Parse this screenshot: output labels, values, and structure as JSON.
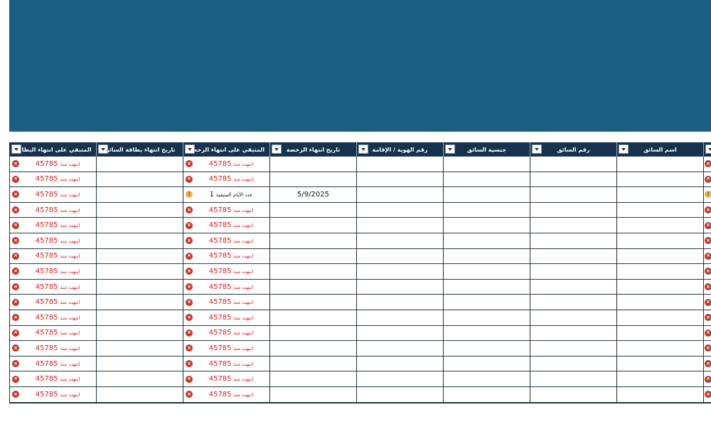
{
  "colors": {
    "banner": "#1b5e84",
    "header_bg": "#16324f",
    "error": "#c0392b",
    "warning": "#e6b54a",
    "error_text": "#e02020"
  },
  "icons": {
    "error": "x-circle-icon",
    "warning": "info-circle-icon",
    "dropdown": "chevron-down-icon"
  },
  "headers": [
    "المتبقي على انتهاء البطاقة",
    "تاريخ انتهاء بطاقة السائق",
    "المتبقي على انتهاء الرخصة",
    "تاريخ انتهاء الرخصة",
    "رقم الهوية / الإقامة",
    "جنسية السائق",
    "رقم السائق",
    "اسم السائق",
    ""
  ],
  "expired_label": "انتهت منذ",
  "expired_value": "45785",
  "remaining_label": "عدد الأيام المتبقية",
  "remaining_value": "1",
  "rows": [
    {
      "card_num": "45785",
      "card_lbl": "انتهت منذ",
      "card_date": "",
      "lic_num": "45785",
      "lic_lbl": "انتهت منذ",
      "lic_date": ""
    },
    {
      "card_num": "45785",
      "card_lbl": "انتهت منذ",
      "card_date": "",
      "lic_num": "45785",
      "lic_lbl": "انتهت منذ",
      "lic_date": ""
    },
    {
      "card_num": "45785",
      "card_lbl": "انتهت منذ",
      "card_date": "",
      "lic_num": "1",
      "lic_lbl": "عدد الأيام المتبقية",
      "lic_date": "5/9/2025"
    },
    {
      "card_num": "45785",
      "card_lbl": "انتهت منذ",
      "card_date": "",
      "lic_num": "45785",
      "lic_lbl": "انتهت منذ",
      "lic_date": ""
    },
    {
      "card_num": "45785",
      "card_lbl": "انتهت منذ",
      "card_date": "",
      "lic_num": "45785",
      "lic_lbl": "انتهت منذ",
      "lic_date": ""
    },
    {
      "card_num": "45785",
      "card_lbl": "انتهت منذ",
      "card_date": "",
      "lic_num": "45785",
      "lic_lbl": "انتهت منذ",
      "lic_date": ""
    },
    {
      "card_num": "45785",
      "card_lbl": "انتهت منذ",
      "card_date": "",
      "lic_num": "45785",
      "lic_lbl": "انتهت منذ",
      "lic_date": ""
    },
    {
      "card_num": "45785",
      "card_lbl": "انتهت منذ",
      "card_date": "",
      "lic_num": "45785",
      "lic_lbl": "انتهت منذ",
      "lic_date": ""
    },
    {
      "card_num": "45785",
      "card_lbl": "انتهت منذ",
      "card_date": "",
      "lic_num": "45785",
      "lic_lbl": "انتهت منذ",
      "lic_date": ""
    },
    {
      "card_num": "45785",
      "card_lbl": "انتهت منذ",
      "card_date": "",
      "lic_num": "45785",
      "lic_lbl": "انتهت منذ",
      "lic_date": ""
    },
    {
      "card_num": "45785",
      "card_lbl": "انتهت منذ",
      "card_date": "",
      "lic_num": "45785",
      "lic_lbl": "انتهت منذ",
      "lic_date": ""
    },
    {
      "card_num": "45785",
      "card_lbl": "انتهت منذ",
      "card_date": "",
      "lic_num": "45785",
      "lic_lbl": "انتهت منذ",
      "lic_date": ""
    },
    {
      "card_num": "45785",
      "card_lbl": "انتهت منذ",
      "card_date": "",
      "lic_num": "45785",
      "lic_lbl": "انتهت منذ",
      "lic_date": ""
    },
    {
      "card_num": "45785",
      "card_lbl": "انتهت منذ",
      "card_date": "",
      "lic_num": "45785",
      "lic_lbl": "انتهت منذ",
      "lic_date": ""
    },
    {
      "card_num": "45785",
      "card_lbl": "انتهت منذ",
      "card_date": "",
      "lic_num": "45785",
      "lic_lbl": "انتهت منذ",
      "lic_date": ""
    },
    {
      "card_num": "45785",
      "card_lbl": "انتهت منذ",
      "card_date": "",
      "lic_num": "45785",
      "lic_lbl": "انتهت منذ",
      "lic_date": ""
    }
  ],
  "row_status": [
    "error",
    "error",
    "warning",
    "error",
    "error",
    "error",
    "error",
    "error",
    "error",
    "error",
    "error",
    "error",
    "error",
    "error",
    "error",
    "error"
  ]
}
